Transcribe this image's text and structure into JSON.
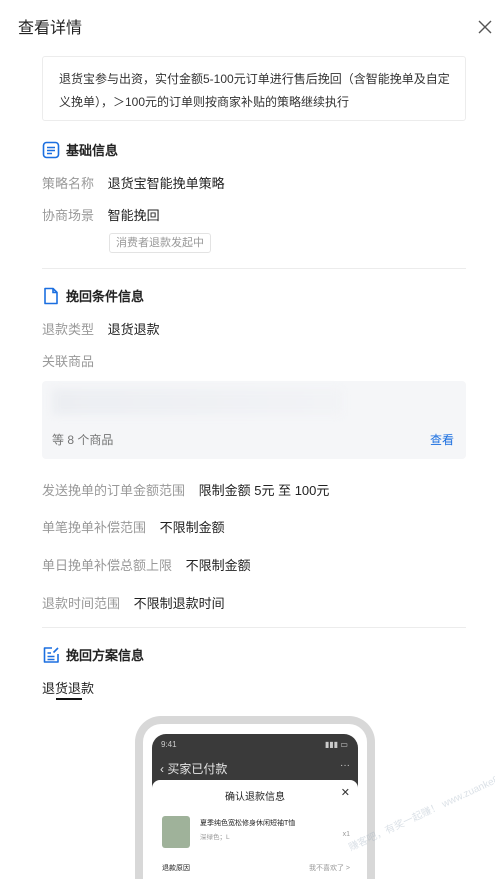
{
  "header": {
    "title": "查看详情",
    "close_icon": "close-icon"
  },
  "notice": "退货宝参与出资，实付金额5-100元订单进行售后挽回（含智能挽单及自定义挽单），＞100元的订单则按商家补贴的策略继续执行",
  "basic": {
    "title": "基础信息",
    "icon": "list-doc-icon",
    "strategy_label": "策略名称",
    "strategy_value": "退货宝智能挽单策略",
    "scene_label": "协商场景",
    "scene_value": "智能挽回",
    "scene_tag": "消费者退款发起中"
  },
  "conditions": {
    "title": "挽回条件信息",
    "icon": "file-icon",
    "refund_type_label": "退款类型",
    "refund_type_value": "退货退款",
    "goods_label": "关联商品",
    "goods_count": "等 8 个商品",
    "goods_view": "查看",
    "order_range_label": "发送挽单的订单金额范围",
    "order_range_value": "限制金额 5元 至 100元",
    "single_comp_label": "单笔挽单补偿范围",
    "single_comp_value": "不限制金额",
    "daily_comp_label": "单日挽单补偿总额上限",
    "daily_comp_value": "不限制金额",
    "refund_time_label": "退款时间范围",
    "refund_time_value": "不限制退款时间"
  },
  "plan": {
    "title": "挽回方案信息",
    "icon": "edit-doc-icon",
    "tab": "退货退款"
  },
  "phone_preview": {
    "time": "9:41",
    "nav_title": "买家已付款",
    "more": "···",
    "sheet_title": "确认退款信息",
    "product_name": "夏季纯色宽松修身休闲短袖T恤",
    "product_spec": "深绿色；L",
    "product_qty": "x1",
    "reason_label": "退款原因",
    "reason_value": "我不喜欢了 >"
  },
  "watermark": "赚客吧，有奖一起赚！ www.zuanke8.com",
  "colors": {
    "accent": "#1b6fe0",
    "text": "#222222",
    "muted": "#999999"
  }
}
